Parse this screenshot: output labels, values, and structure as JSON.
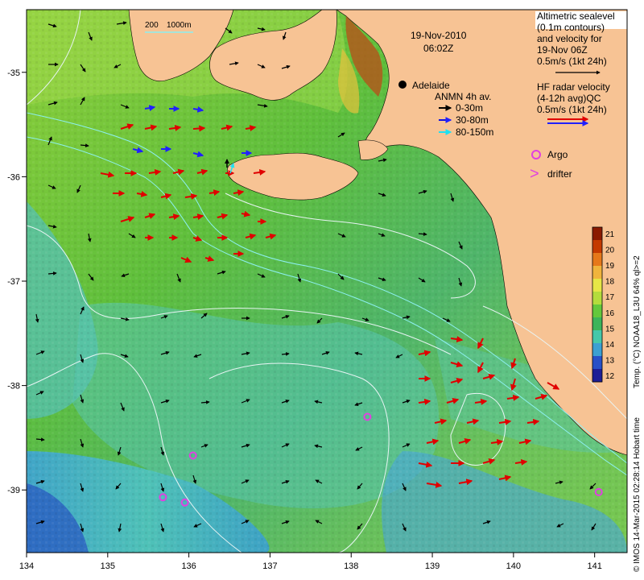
{
  "map": {
    "date": "19-Nov-2010",
    "time": "06:02Z",
    "city": "Adelaide",
    "lon_ticks": [
      "134",
      "135",
      "136",
      "137",
      "138",
      "139",
      "140",
      "141"
    ],
    "lat_ticks": [
      "-35",
      "-36",
      "-37",
      "-38",
      "-39"
    ],
    "lon_range": [
      134,
      141.4
    ],
    "lat_range": [
      -39.6,
      -34.4
    ],
    "bathy_scale": {
      "left": "200",
      "right": "1000m"
    },
    "credit": "© IMOS 14-Mar-2015 02:28:14 Hobart time"
  },
  "legend_altimetry": {
    "lines": [
      "Altimetric sealevel",
      "(0.1m contours)",
      "and velocity for",
      "19-Nov 06Z",
      "0.5m/s (1kt 24h)"
    ]
  },
  "legend_hf": {
    "lines": [
      "HF radar velocity",
      "(4-12h avg)QC",
      "0.5m/s (1kt 24h)"
    ],
    "colors": [
      "#e00000",
      "#2020ff"
    ]
  },
  "legend_anmn": {
    "title": "ANMN 4h av.",
    "items": [
      {
        "label": "0-30m",
        "color": "#000000"
      },
      {
        "label": "30-80m",
        "color": "#1010e0"
      },
      {
        "label": "80-150m",
        "color": "#20e0f0"
      }
    ]
  },
  "legend_markers": {
    "argo": {
      "label": "Argo",
      "color": "#e040e0"
    },
    "drifter": {
      "label": "drifter",
      "color": "#e040e0",
      "glyph": ">"
    }
  },
  "colorbar": {
    "title": "Temp. (°C) NOAA18_L3U 64% ql>=2",
    "ticks": [
      "21",
      "20",
      "19",
      "18",
      "17",
      "16",
      "15",
      "14",
      "13",
      "12"
    ],
    "colors": [
      "#8b1a00",
      "#c43a00",
      "#e6781a",
      "#f0b43c",
      "#e6e646",
      "#b4dc3c",
      "#64c83c",
      "#3cb45a",
      "#46c8aa",
      "#3ca0d2",
      "#2850c8",
      "#1e1e96"
    ]
  },
  "argo_floats": [
    {
      "lon": 138.2,
      "lat": -38.3
    },
    {
      "lon": 136.05,
      "lat": -38.67
    },
    {
      "lon": 135.68,
      "lat": -39.07
    },
    {
      "lon": 135.95,
      "lat": -39.12
    },
    {
      "lon": 141.05,
      "lat": -39.02
    }
  ]
}
